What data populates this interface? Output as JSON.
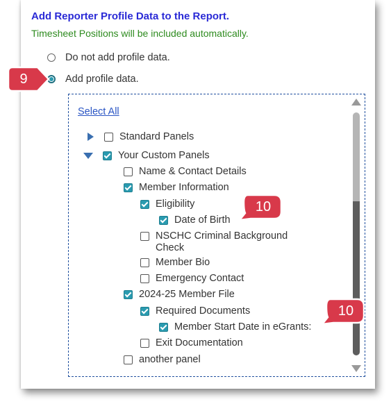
{
  "header": {
    "title": "Add Reporter Profile Data to the Report.",
    "subtitle": "Timesheet Positions will be included automatically."
  },
  "options": [
    {
      "label": "Do not add profile data.",
      "selected": false
    },
    {
      "label": "Add profile data.",
      "selected": true
    }
  ],
  "tree": {
    "select_all": "Select All",
    "nodes": [
      {
        "label": "Standard Panels",
        "checked": false,
        "expander": "collapsed"
      },
      {
        "label": "Your Custom Panels",
        "checked": true,
        "expander": "expanded"
      },
      {
        "label": "Name & Contact Details",
        "checked": false
      },
      {
        "label": "Member Information",
        "checked": true
      },
      {
        "label": "Eligibility",
        "checked": true
      },
      {
        "label": "Date of Birth",
        "checked": true
      },
      {
        "label": "NSCHC Criminal Background Check",
        "checked": false
      },
      {
        "label": "Member Bio",
        "checked": false
      },
      {
        "label": "Emergency Contact",
        "checked": false
      },
      {
        "label": "2024-25 Member File",
        "checked": true
      },
      {
        "label": "Required Documents",
        "checked": true
      },
      {
        "label": "Member Start Date in eGrants:",
        "checked": true
      },
      {
        "label": "Exit Documentation",
        "checked": false
      },
      {
        "label": "another panel",
        "checked": false
      }
    ]
  },
  "callouts": [
    {
      "number": "9"
    },
    {
      "number": "10"
    },
    {
      "number": "10"
    }
  ],
  "colors": {
    "title": "#2a2ad6",
    "subtitle": "#2e8b1f",
    "checkbox": "#2a9bb0",
    "callout": "#d8394a"
  }
}
